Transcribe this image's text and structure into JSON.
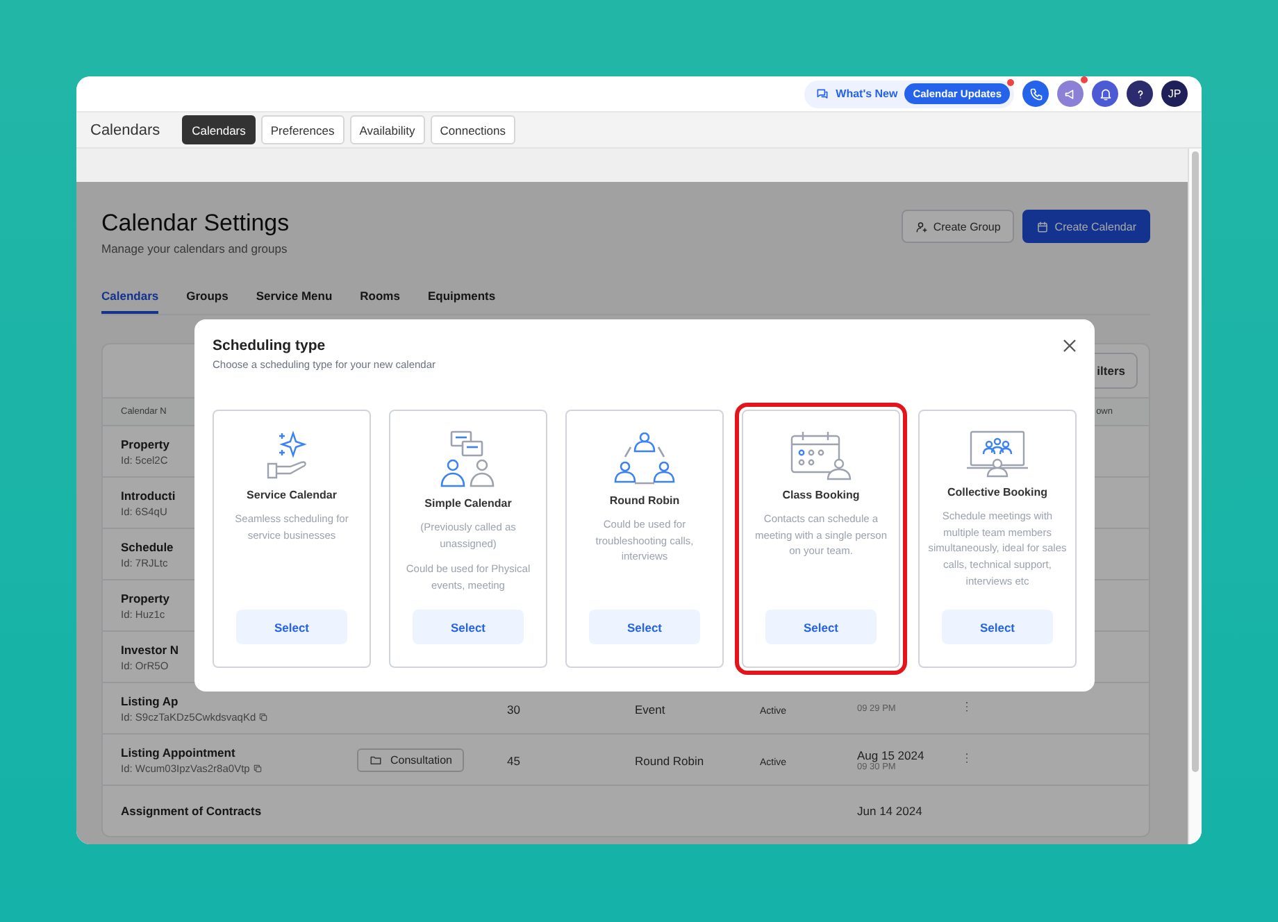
{
  "top_bar": {
    "whats_new": "What's New",
    "updates": "Calendar Updates",
    "updates_dot": true,
    "megaphone_dot": true,
    "avatar": "JP"
  },
  "nav": {
    "title": "Calendars",
    "tabs": [
      {
        "label": "Calendars",
        "selected": true
      },
      {
        "label": "Preferences",
        "selected": false
      },
      {
        "label": "Availability",
        "selected": false
      },
      {
        "label": "Connections",
        "selected": false
      }
    ]
  },
  "page": {
    "title": "Calendar Settings",
    "subtitle": "Manage your calendars and groups",
    "buttons": [
      {
        "label": "Create Group",
        "kind": "secondary"
      },
      {
        "label": "Create Calendar",
        "kind": "primary"
      }
    ],
    "tabs": [
      {
        "label": "Calendars",
        "selected": true
      },
      {
        "label": "Groups",
        "selected": false
      },
      {
        "label": "Service Menu",
        "selected": false
      },
      {
        "label": "Rooms",
        "selected": false
      },
      {
        "label": "Equipments",
        "selected": false
      }
    ]
  },
  "table": {
    "filters": "ilters",
    "columns": [
      "Calendar N",
      "own"
    ],
    "rows": [
      {
        "name": "Property",
        "id": "Id: 5cel2C"
      },
      {
        "name": "Introducti",
        "id": "Id: 6S4qU"
      },
      {
        "name": "Schedule",
        "id": "Id: 7RJLtc"
      },
      {
        "name": "Property",
        "id": "Id: Huz1c"
      },
      {
        "name": "Investor N",
        "id": "Id: OrR5O"
      },
      {
        "name": "Listing Ap",
        "id": "Id: S9czTaKDz5CwkdsvaqKd",
        "copy": true,
        "duration": "30",
        "type": "Event",
        "status": "Active",
        "time": "09 29 PM",
        "menu": true
      },
      {
        "name": "Listing Appointment",
        "id": "Id: Wcum03IpzVas2r8a0Vtp",
        "copy": true,
        "group": "Consultation",
        "duration": "45",
        "type": "Round Robin",
        "status": "Active",
        "date": "Aug 15 2024",
        "time": "09 30 PM",
        "menu": true
      },
      {
        "name": "Assignment of Contracts",
        "date": "Jun 14 2024"
      }
    ]
  },
  "modal": {
    "title": "Scheduling type",
    "subtitle": "Choose a scheduling type for your new calendar",
    "cards": [
      {
        "kind": "service",
        "title": "Service Calendar",
        "descriptions": [
          "Seamless scheduling for service businesses"
        ],
        "button": "Select",
        "highlighted": false
      },
      {
        "kind": "simple",
        "title": "Simple Calendar",
        "descriptions": [
          "(Previously called as unassigned)",
          "Could be used for Physical events, meeting"
        ],
        "button": "Select",
        "highlighted": false
      },
      {
        "kind": "round",
        "title": "Round Robin",
        "descriptions": [
          "Could be used for troubleshooting calls, interviews"
        ],
        "button": "Select",
        "highlighted": false
      },
      {
        "kind": "class",
        "title": "Class Booking",
        "descriptions": [
          "Contacts can schedule a meeting with a single person on your team."
        ],
        "button": "Select",
        "highlighted": true
      },
      {
        "kind": "collective",
        "title": "Collective Booking",
        "descriptions": [
          "Schedule meetings with multiple team members simultaneously, ideal for sales calls, technical support, interviews etc"
        ],
        "button": "Select",
        "highlighted": false
      }
    ]
  }
}
